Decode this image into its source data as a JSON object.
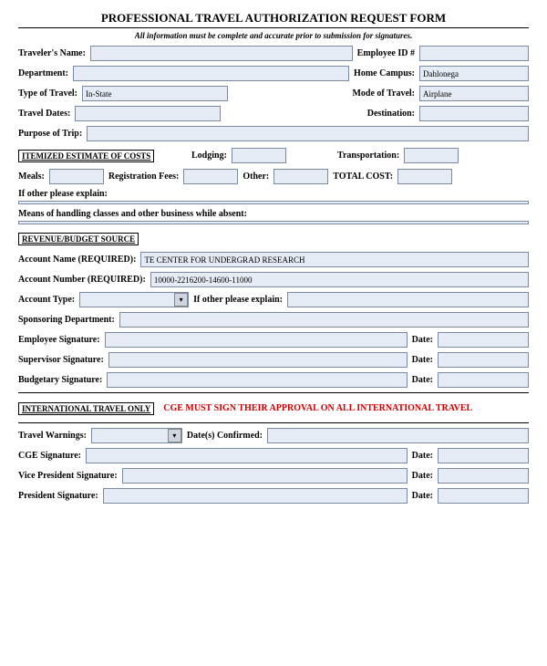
{
  "title": "PROFESSIONAL TRAVEL AUTHORIZATION REQUEST FORM",
  "subtitle": "All information must be complete and accurate prior to submission for signatures.",
  "labels": {
    "traveler_name": "Traveler's Name:",
    "employee_id": "Employee ID #",
    "department": "Department:",
    "home_campus": "Home Campus:",
    "type_of_travel": "Type of Travel:",
    "mode_of_travel": "Mode of Travel:",
    "travel_dates": "Travel Dates:",
    "destination": "Destination:",
    "purpose": "Purpose of Trip:",
    "itemized": "ITEMIZED ESTIMATE OF COSTS",
    "lodging": "Lodging:",
    "transportation": "Transportation:",
    "meals": "Meals:",
    "registration": "Registration Fees:",
    "other": "Other:",
    "total": "TOTAL COST:",
    "other_explain": "If other please explain:",
    "means": "Means of handling classes and other business while absent:",
    "revenue": "REVENUE/BUDGET SOURCE",
    "account_name": "Account Name (REQUIRED):",
    "account_number": "Account Number (REQUIRED):",
    "account_type": "Account Type:",
    "sponsoring": "Sponsoring Department:",
    "emp_sig": "Employee Signature:",
    "sup_sig": "Supervisor Signature:",
    "bud_sig": "Budgetary Signature:",
    "date": "Date:",
    "intl": "INTERNATIONAL TRAVEL ONLY",
    "intl_note": "CGE MUST SIGN THEIR APPROVAL ON ALL INTERNATIONAL TRAVEL",
    "warnings": "Travel Warnings:",
    "dates_confirmed": "Date(s) Confirmed:",
    "cge_sig": "CGE Signature:",
    "vp_sig": "Vice President Signature:",
    "pres_sig": "President Signature:"
  },
  "values": {
    "home_campus": "Dahlonega",
    "type_of_travel": "In-State",
    "mode_of_travel": "Airplane",
    "account_name": "TE CENTER FOR UNDERGRAD RESEARCH",
    "account_number": "10000-2216200-14600-11000"
  }
}
